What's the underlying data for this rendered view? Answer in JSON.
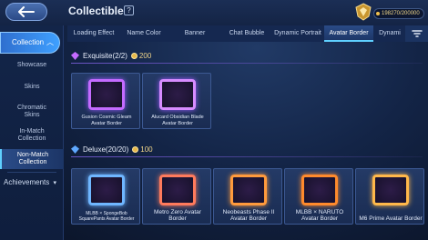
{
  "header": {
    "title": "Collectible",
    "currency_value": "198270/200000"
  },
  "tabs": [
    {
      "label": "Loading Effect",
      "active": false
    },
    {
      "label": "Name Color",
      "active": false
    },
    {
      "label": "Banner",
      "active": false
    },
    {
      "label": "Chat Bubble",
      "active": false
    },
    {
      "label": "Dynamic Portrait",
      "active": false
    },
    {
      "label": "Avatar Border",
      "active": true
    },
    {
      "label": "Dynami",
      "active": false
    }
  ],
  "sidebar": {
    "main_label": "Collection",
    "items": [
      {
        "label": "Showcase",
        "active": false
      },
      {
        "label": "Skins",
        "active": false
      },
      {
        "label": "Chromatic Skins",
        "active": false
      },
      {
        "label": "In-Match Collection",
        "active": false
      },
      {
        "label": "Non-Match Collection",
        "active": true
      }
    ],
    "bottom_label": "Achievements"
  },
  "sections": [
    {
      "title": "Exquisite(2/2)",
      "count": "200",
      "items": [
        {
          "label": "Gusion Cosmic Gleam Avatar Border",
          "color": "#c46bff"
        },
        {
          "label": "Alucard Obsidian Blade Avatar Border",
          "color": "#d78cff"
        }
      ]
    },
    {
      "title": "Deluxe(20/20)",
      "count": "100",
      "items": [
        {
          "label": "MLBB × SpongeBob SquarePants Avatar Border",
          "color": "#6fb6ff"
        },
        {
          "label": "Metro Zero Avatar Border",
          "color": "#ff7a5c"
        },
        {
          "label": "Neobeasts Phase II Avatar Border",
          "color": "#ff9a3c"
        },
        {
          "label": "MLBB × NARUTO Avatar Border",
          "color": "#ff8a2c"
        },
        {
          "label": "M6 Prime Avatar Border",
          "color": "#ffb84a"
        }
      ]
    }
  ],
  "colors": {
    "accent": "#5fd0ff",
    "exquisite": "#c46bff",
    "gold": "#f0d58a"
  }
}
